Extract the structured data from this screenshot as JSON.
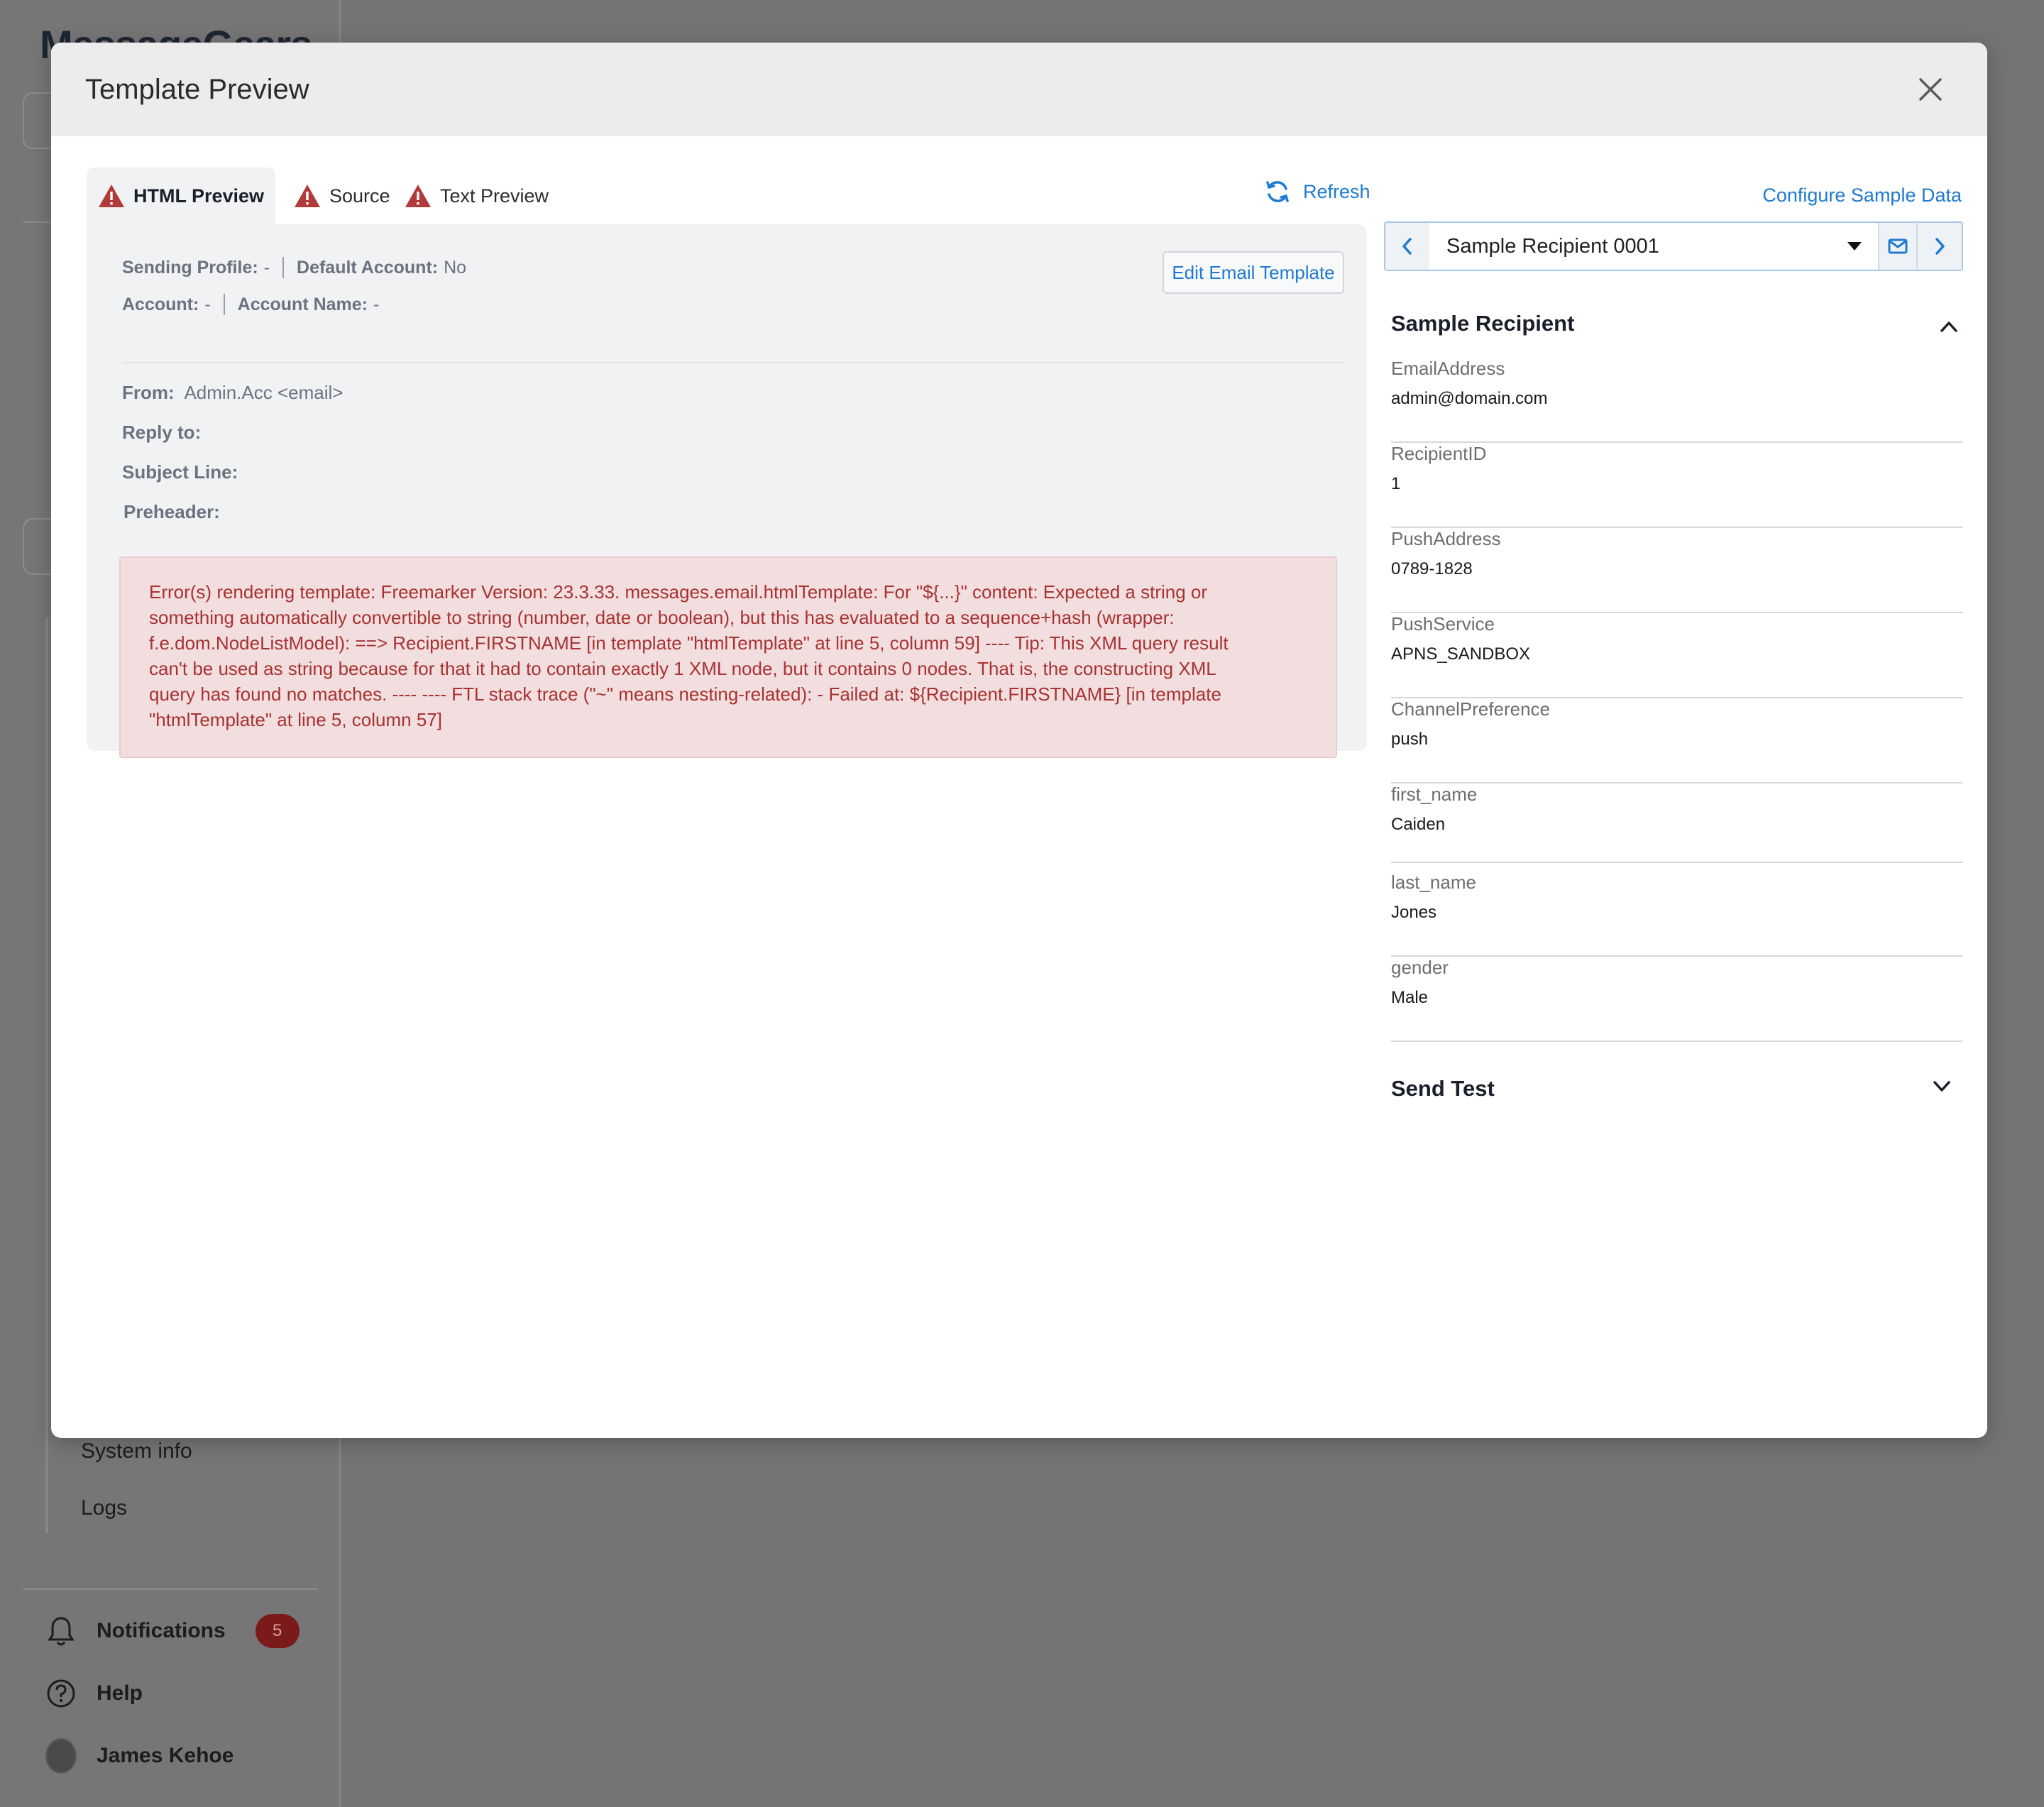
{
  "background_app": {
    "logo_text": "MessageGears",
    "sidebar_links": [
      "System info",
      "Logs"
    ],
    "notifications": {
      "label": "Notifications",
      "count": "5"
    },
    "help_label": "Help",
    "user_name": "James Kehoe"
  },
  "modal": {
    "title": "Template Preview",
    "tabs": [
      {
        "label": "HTML Preview",
        "active": true,
        "warning": true
      },
      {
        "label": "Source",
        "active": false,
        "warning": true
      },
      {
        "label": "Text Preview",
        "active": false,
        "warning": true
      }
    ],
    "refresh_label": "Refresh",
    "configure_label": "Configure Sample Data",
    "preview": {
      "sending_profile": {
        "key": "Sending Profile:",
        "value": "-"
      },
      "default_account": {
        "key": "Default Account:",
        "value": "No"
      },
      "account": {
        "key": "Account:",
        "value": "-"
      },
      "account_name": {
        "key": "Account Name:",
        "value": "-"
      },
      "edit_button": "Edit Email Template",
      "from": {
        "key": "From:",
        "value": "Admin.Acc <email>"
      },
      "reply_to": {
        "key": "Reply to:",
        "value": ""
      },
      "subject_line": {
        "key": "Subject Line:",
        "value": ""
      },
      "preheader": {
        "key": "Preheader:",
        "value": ""
      },
      "error_lines": [
        "Error(s) rendering template: Freemarker Version: 23.3.33. messages.email.htmlTemplate: For \"${...}\" content: Expected a string or",
        "something automatically convertible to string (number, date or boolean), but this has evaluated to a sequence+hash (wrapper:",
        "f.e.dom.NodeListModel): ==> Recipient.FIRSTNAME [in template \"htmlTemplate\" at line 5, column 59] ---- Tip: This XML query result",
        "can't be used as string because for that it had to contain exactly 1 XML node, but it contains 0 nodes. That is, the constructing XML",
        "query has found no matches. ---- ---- FTL stack trace (\"~\" means nesting-related): - Failed at: ${Recipient.FIRSTNAME} [in template",
        "\"htmlTemplate\" at line 5, column 57]"
      ]
    },
    "recipient_select": {
      "value": "Sample Recipient 0001"
    },
    "sample_recipient": {
      "title": "Sample Recipient",
      "fields": [
        {
          "label": "EmailAddress",
          "value": "admin@domain.com"
        },
        {
          "label": "RecipientID",
          "value": "1"
        },
        {
          "label": "PushAddress",
          "value": "0789-1828"
        },
        {
          "label": "PushService",
          "value": "APNS_SANDBOX"
        },
        {
          "label": "ChannelPreference",
          "value": "push"
        },
        {
          "label": "first_name",
          "value": "Caiden"
        },
        {
          "label": "last_name",
          "value": "Jones"
        },
        {
          "label": "gender",
          "value": "Male"
        }
      ]
    },
    "send_test": {
      "title": "Send Test"
    }
  },
  "colors": {
    "accent": "#1f7ad1",
    "error_bg": "#f2dede",
    "error_text": "#a83232",
    "warning_icon": "#b13a3a",
    "overlay": "#747474"
  },
  "icons": {
    "close": "close-icon",
    "warning": "warning-triangle-icon",
    "refresh": "refresh-icon",
    "prev": "chevron-left-icon",
    "next": "chevron-right-icon",
    "dropdown": "caret-down-icon",
    "mail": "envelope-icon",
    "collapse": "chevron-up-icon",
    "expand": "chevron-down-icon",
    "bell": "bell-icon",
    "help": "question-circle-icon"
  }
}
